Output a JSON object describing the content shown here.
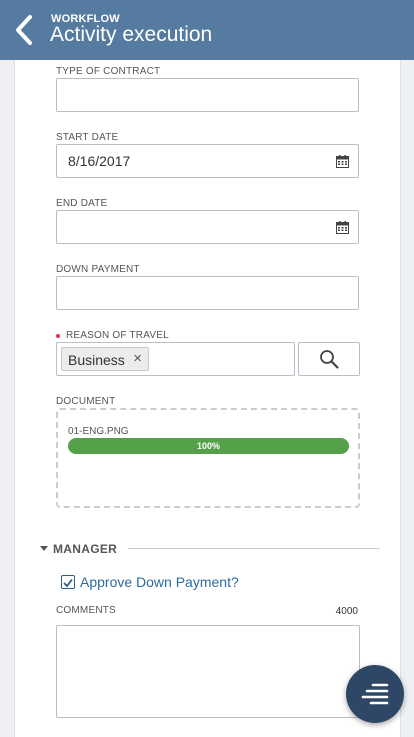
{
  "header": {
    "overline": "WORKFLOW",
    "title": "Activity execution"
  },
  "form": {
    "type_of_contract": {
      "label": "TYPE OF CONTRACT",
      "value": ""
    },
    "start_date": {
      "label": "START DATE",
      "value": "8/16/2017"
    },
    "end_date": {
      "label": "END DATE",
      "value": ""
    },
    "down_payment": {
      "label": "DOWN PAYMENT",
      "value": ""
    },
    "reason_of_travel": {
      "label": "REASON OF TRAVEL",
      "required": true,
      "tags": [
        "Business"
      ],
      "remove_glyph": "×"
    },
    "document": {
      "label": "DOCUMENT",
      "file_name": "01-ENG.PNG",
      "progress": 100,
      "progress_text": "100%"
    }
  },
  "manager_section": {
    "title": "MANAGER",
    "approve_checkbox": {
      "label": "Approve Down Payment?",
      "checked": true
    },
    "comments": {
      "label": "COMMENTS",
      "max_chars": "4000",
      "value": ""
    }
  },
  "icons": {
    "back": "chevron-left-icon",
    "calendar": "calendar-icon",
    "search": "search-icon",
    "fab": "menu-lines-icon"
  },
  "colors": {
    "header": "#567ba0",
    "progress": "#54a14a",
    "fab": "#2e4766",
    "link": "#2c6aa0",
    "required": "#e0344a"
  }
}
